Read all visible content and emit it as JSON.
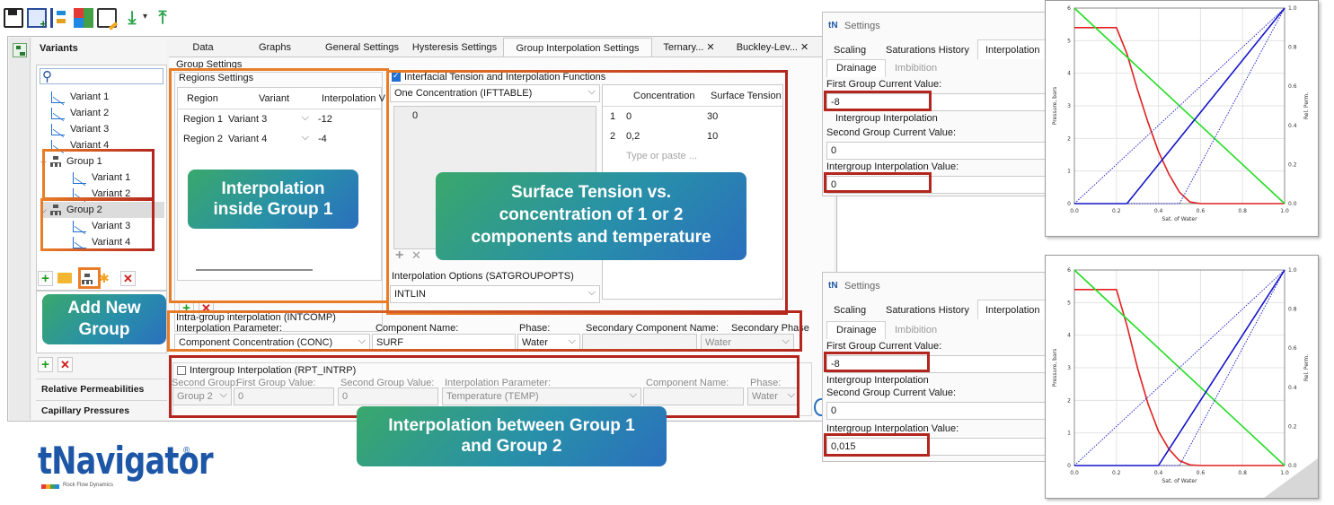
{
  "colors": {
    "accent_orange": "#e97d27",
    "accent_red": "#b3261e",
    "curve_red": "#e02020",
    "curve_green": "#22dd22",
    "curve_blue": "#1414c8"
  },
  "toolbar": {
    "icons": [
      "save-icon",
      "add-variant-icon",
      "tree-icon",
      "color-icon",
      "edit-icon",
      "download-icon",
      "dropdown-icon",
      "upload-icon"
    ]
  },
  "variants_panel": {
    "title": "Variants",
    "search_value": "",
    "tree": [
      {
        "label": "Variant 1"
      },
      {
        "label": "Variant 2"
      },
      {
        "label": "Variant 3"
      },
      {
        "label": "Variant 4"
      },
      {
        "label": "Group 1",
        "children": [
          "Variant 1",
          "Variant 2"
        ]
      },
      {
        "label": "Group 2",
        "children": [
          "Variant 3",
          "Variant 4"
        ]
      }
    ],
    "bottom_items": [
      "Relative Permeabilities",
      "Capillary Pressures"
    ]
  },
  "tabs": [
    "Data",
    "Graphs",
    "General Settings",
    "Hysteresis Settings",
    "Group Interpolation Settings",
    "Ternary... ✕",
    "Buckley-Lev... ✕"
  ],
  "group_settings": {
    "title": "Group Settings",
    "regions": {
      "title": "Regions Settings",
      "headers": [
        "Region",
        "Variant",
        "Interpolation V"
      ],
      "rows": [
        [
          "Region 1",
          "Variant 3",
          "-12"
        ],
        [
          "Region 2",
          "Variant 4",
          "-4"
        ]
      ]
    },
    "ift": {
      "checkbox_label": "Interfacial Tension and Interpolation Functions",
      "mode": "One Concentration (IFTTABLE)",
      "list_value": "0",
      "table_headers": [
        "Concentration",
        "Surface Tension"
      ],
      "table_rows": [
        [
          "1",
          "0",
          "30"
        ],
        [
          "2",
          "0,2",
          "10"
        ]
      ],
      "placeholder": "Type or paste ...",
      "interp_options_label": "Interpolation Options (SATGROUPOPTS)",
      "interp_options_value": "INTLIN"
    },
    "intcomp": {
      "title": "Intra-group interpolation (INTCOMP)",
      "labels": [
        "Interpolation Parameter:",
        "Component Name:",
        "Phase:",
        "Secondary Component Name:",
        "Secondary Phase"
      ],
      "values": [
        "Component Concentration (CONC)",
        "SURF",
        "Water",
        "",
        "Water"
      ]
    },
    "rpt": {
      "checkbox_label": "Intergroup Interpolation (RPT_INTRP)",
      "labels": [
        "Second Group:",
        "First Group Value:",
        "Second Group Value:",
        "Interpolation Parameter:",
        "Component Name:",
        "Phase:"
      ],
      "values": [
        "Group 2",
        "0",
        "0",
        "Temperature (TEMP)",
        "",
        "Water"
      ]
    }
  },
  "callouts": {
    "inside": "Interpolation inside Group 1",
    "surface": "Surface Tension vs. concentration of 1 or 2 components and temperature",
    "add_group": "Add New Group",
    "between": "Interpolation between Group 1 and Group 2"
  },
  "logo": {
    "text": "tNavigator",
    "reg": "®",
    "tagline": "Rock Flow Dynamics"
  },
  "settings_windows": [
    {
      "title": "Settings",
      "tabs": [
        "Scaling",
        "Saturations History",
        "Interpolation"
      ],
      "subtabs": [
        "Drainage",
        "Imbibition"
      ],
      "first_label": "First Group Current Value:",
      "first_value": "-8",
      "intergroup_title": "Intergroup Interpolation",
      "second_label": "Second Group Current Value:",
      "second_value": "0",
      "inter_label": "Intergroup Interpolation Value:",
      "inter_value": "0"
    },
    {
      "title": "Settings",
      "tabs": [
        "Scaling",
        "Saturations History",
        "Interpolation"
      ],
      "subtabs": [
        "Drainage",
        "Imbibition"
      ],
      "first_label": "First Group Current Value:",
      "first_value": "-8",
      "intergroup_title": "Intergroup Interpolation",
      "second_label": "Second Group Current Value:",
      "second_value": "0",
      "inter_label": "Intergroup Interpolation Value:",
      "inter_value": "0,015"
    }
  ],
  "chart_data": [
    {
      "type": "line",
      "title": "",
      "xlabel": "Sat. of Water",
      "ylabel": "Pressure, bars",
      "y2label": "Rel. Perm.",
      "xlim": [
        0,
        1
      ],
      "ylim": [
        0,
        6
      ],
      "y2lim": [
        0,
        1
      ],
      "xticks": [
        "0.0",
        "0.2",
        "0.4",
        "0.6",
        "0.8",
        "1.0"
      ],
      "yticks": [
        "0",
        "1",
        "2",
        "3",
        "4",
        "5",
        "6"
      ],
      "y2ticks": [
        "0.0",
        "0.2",
        "0.4",
        "0.6",
        "0.8",
        "1.0"
      ],
      "series": [
        {
          "axis": "left",
          "color": "#e02020",
          "dash": false,
          "points": [
            [
              0,
              5.4
            ],
            [
              0.2,
              5.4
            ],
            [
              0.25,
              4.6
            ],
            [
              0.3,
              3.5
            ],
            [
              0.35,
              2.5
            ],
            [
              0.4,
              1.6
            ],
            [
              0.45,
              0.9
            ],
            [
              0.5,
              0.35
            ],
            [
              0.55,
              0.05
            ],
            [
              0.6,
              0
            ],
            [
              1,
              0
            ]
          ]
        },
        {
          "axis": "right",
          "color": "#22dd22",
          "dash": false,
          "points": [
            [
              0,
              1
            ],
            [
              1,
              0
            ]
          ]
        },
        {
          "axis": "right",
          "color": "#1414c8",
          "dash": false,
          "points": [
            [
              0,
              0
            ],
            [
              0.25,
              0
            ],
            [
              1,
              1
            ]
          ]
        },
        {
          "axis": "right",
          "color": "#1414c8",
          "dash": true,
          "points": [
            [
              0,
              0
            ],
            [
              1,
              1
            ]
          ]
        },
        {
          "axis": "right",
          "color": "#1414c8",
          "dash": true,
          "points": [
            [
              0,
              0
            ],
            [
              0.5,
              0
            ],
            [
              1,
              1
            ]
          ]
        }
      ]
    },
    {
      "type": "line",
      "title": "",
      "xlabel": "Sat. of Water",
      "ylabel": "Pressure, bars",
      "y2label": "Rel. Perm.",
      "xlim": [
        0,
        1
      ],
      "ylim": [
        0,
        6
      ],
      "y2lim": [
        0,
        1
      ],
      "xticks": [
        "0.0",
        "0.2",
        "0.4",
        "0.6",
        "0.8",
        "1.0"
      ],
      "yticks": [
        "0",
        "1",
        "2",
        "3",
        "4",
        "5",
        "6"
      ],
      "y2ticks": [
        "0.0",
        "0.2",
        "0.4",
        "0.6",
        "0.8",
        "1.0"
      ],
      "series": [
        {
          "axis": "left",
          "color": "#e02020",
          "dash": false,
          "points": [
            [
              0,
              5.4
            ],
            [
              0.2,
              5.4
            ],
            [
              0.25,
              4.3
            ],
            [
              0.3,
              3.0
            ],
            [
              0.35,
              1.9
            ],
            [
              0.4,
              1.05
            ],
            [
              0.45,
              0.5
            ],
            [
              0.5,
              0.15
            ],
            [
              0.55,
              0.02
            ],
            [
              0.6,
              0
            ],
            [
              1,
              0
            ]
          ]
        },
        {
          "axis": "right",
          "color": "#22dd22",
          "dash": false,
          "points": [
            [
              0,
              1
            ],
            [
              1,
              0
            ]
          ]
        },
        {
          "axis": "right",
          "color": "#1414c8",
          "dash": false,
          "points": [
            [
              0,
              0
            ],
            [
              0.4,
              0
            ],
            [
              1,
              1
            ]
          ]
        },
        {
          "axis": "right",
          "color": "#1414c8",
          "dash": true,
          "points": [
            [
              0,
              0
            ],
            [
              1,
              1
            ]
          ]
        },
        {
          "axis": "right",
          "color": "#1414c8",
          "dash": true,
          "points": [
            [
              0,
              0
            ],
            [
              0.5,
              0
            ],
            [
              1,
              1
            ]
          ]
        }
      ]
    }
  ]
}
